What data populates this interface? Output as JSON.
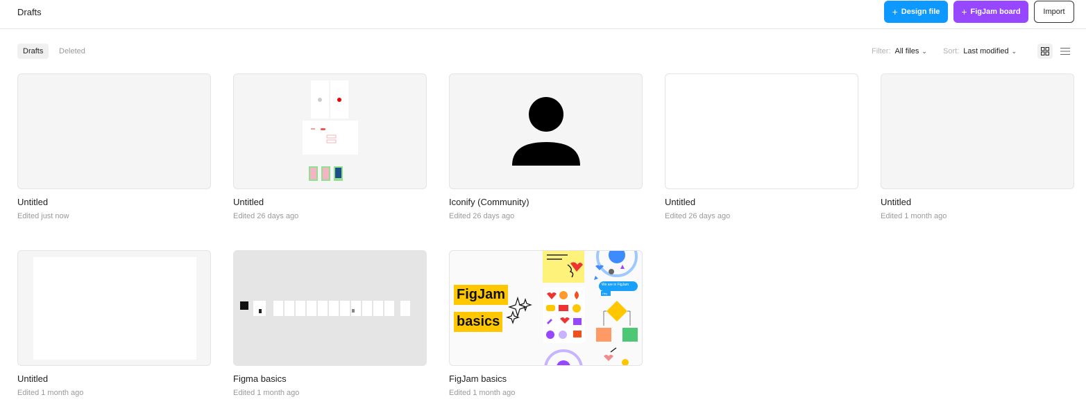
{
  "header": {
    "title": "Drafts",
    "design_file_label": "Design file",
    "figjam_board_label": "FigJam board",
    "import_label": "Import"
  },
  "tabs": [
    {
      "label": "Drafts",
      "active": true
    },
    {
      "label": "Deleted",
      "active": false
    }
  ],
  "filter": {
    "label": "Filter:",
    "value": "All files"
  },
  "sort": {
    "label": "Sort:",
    "value": "Last modified"
  },
  "view_mode": "grid",
  "files": [
    {
      "name": "Untitled",
      "edited": "Edited just now",
      "thumb": "blank-gray"
    },
    {
      "name": "Untitled",
      "edited": "Edited 26 days ago",
      "thumb": "wireframe"
    },
    {
      "name": "Iconify (Community)",
      "edited": "Edited 26 days ago",
      "thumb": "user-icon"
    },
    {
      "name": "Untitled",
      "edited": "Edited 26 days ago",
      "thumb": "blank-white"
    },
    {
      "name": "Untitled",
      "edited": "Edited 1 month ago",
      "thumb": "blank-gray"
    },
    {
      "name": "Untitled",
      "edited": "Edited 1 month ago",
      "thumb": "white-frame"
    },
    {
      "name": "Figma basics",
      "edited": "Edited 1 month ago",
      "thumb": "figma-basics"
    },
    {
      "name": "FigJam basics",
      "edited": "Edited 1 month ago",
      "thumb": "figjam-basics"
    }
  ],
  "figjam_thumb": {
    "line1": "FigJam",
    "line2": "basics",
    "bubble": "We are in FigJam",
    "tag": "Hey"
  },
  "colors": {
    "design": "#0d99ff",
    "figjam": "#9747ff",
    "sticky": "#ffc700"
  }
}
